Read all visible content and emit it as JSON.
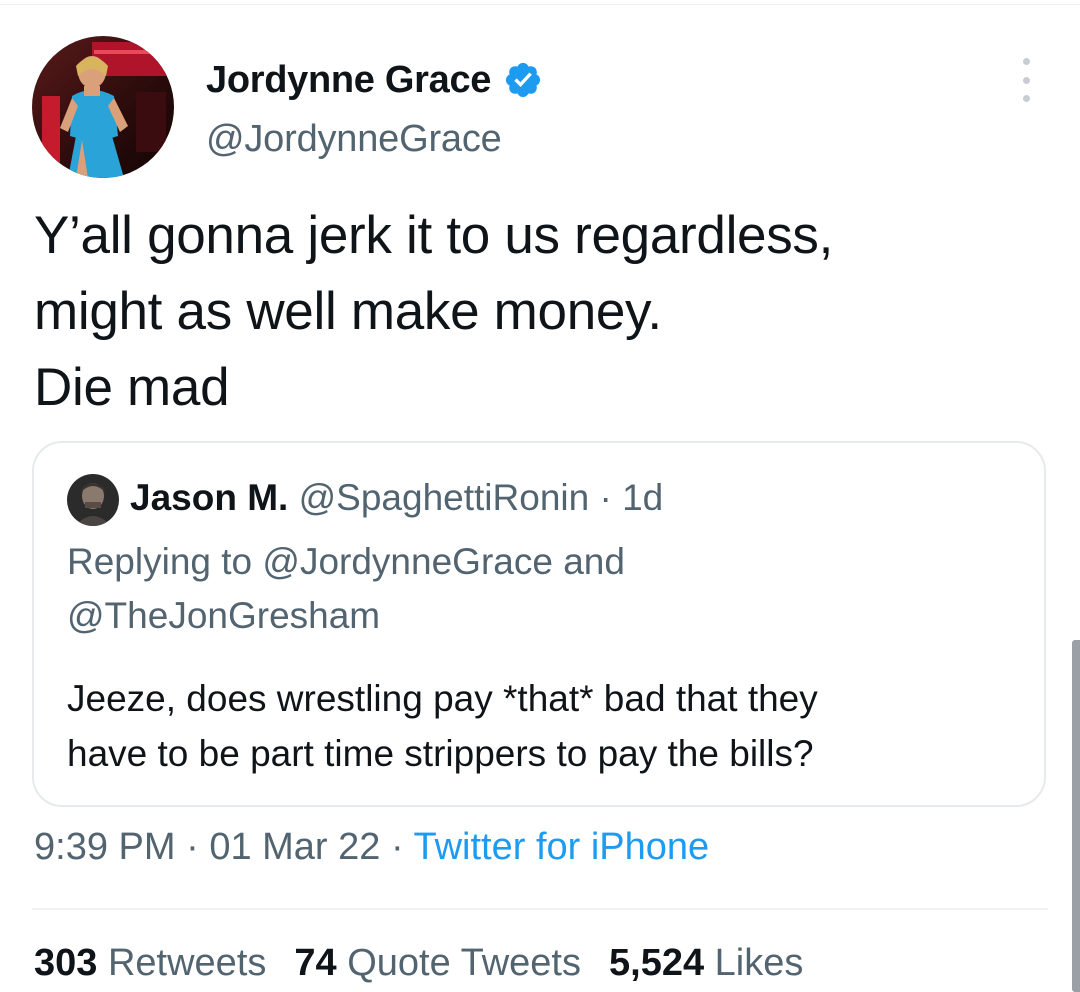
{
  "tweet": {
    "author": {
      "name": "Jordynne Grace",
      "handle": "@JordynneGrace",
      "verified": true,
      "avatar_icon": "profile-photo"
    },
    "text_lines": [
      "Y’all gonna jerk it to us regardless,",
      "might as well make money.",
      "Die mad"
    ],
    "quoted": {
      "author_name": "Jason M.",
      "handle": "@SpaghettiRonin",
      "separator": " · ",
      "age": "1d",
      "replying_lines": [
        "Replying to @JordynneGrace and",
        "@TheJonGresham"
      ],
      "text_lines": [
        "Jeeze, does wrestling pay *that* bad that they",
        "have to be part time strippers to pay the bills?"
      ]
    },
    "time": "9:39 PM",
    "date": "01 Mar 22",
    "source": "Twitter for iPhone",
    "dot": " · ",
    "stats": {
      "retweets_count": "303",
      "retweets_label": "Retweets",
      "quotes_count": "74",
      "quotes_label": "Quote Tweets",
      "likes_count": "5,524",
      "likes_label": "Likes"
    }
  },
  "colors": {
    "verified_badge": "#1d9bf0",
    "link": "#1d9bf0",
    "secondary_text": "#536471"
  }
}
